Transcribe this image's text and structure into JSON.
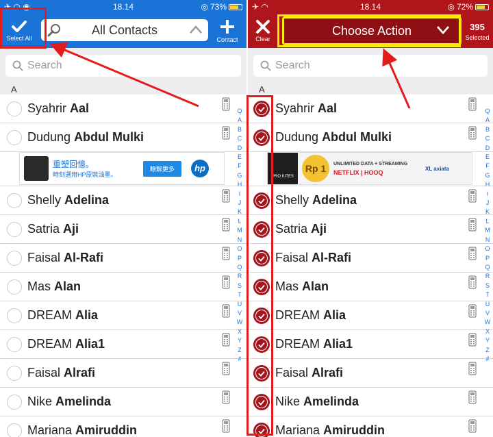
{
  "left": {
    "status": {
      "time": "18.14",
      "battery": "73%",
      "battery_level": 0.73
    },
    "select_all_label": "Select All",
    "title": "All Contacts",
    "add_label": "Contact",
    "search_placeholder": "Search",
    "section": "A",
    "contacts": [
      {
        "first": "Syahrir ",
        "last": "Aal"
      },
      {
        "first": "Dudung ",
        "last": "Abdul Mulki"
      },
      {
        "first": "Shelly ",
        "last": "Adelina"
      },
      {
        "first": "Satria ",
        "last": "Aji"
      },
      {
        "first": "Faisal ",
        "last": "Al-Rafi"
      },
      {
        "first": "Mas ",
        "last": "Alan"
      },
      {
        "first": "DREAM ",
        "last": "Alia"
      },
      {
        "first": "DREAM ",
        "last": "Alia1"
      },
      {
        "first": "Faisal ",
        "last": "Alrafi"
      },
      {
        "first": "Nike ",
        "last": "Amelinda"
      },
      {
        "first": "Mariana ",
        "last": "Amiruddin"
      }
    ],
    "ad": {
      "headline": "重塑回憶。",
      "sub": "時刻選用HP原裝油墨。",
      "cta": "瞭解更多",
      "brand": "hp"
    }
  },
  "right": {
    "status": {
      "time": "18.14",
      "battery": "72%",
      "battery_level": 0.72
    },
    "clear_label": "Clear",
    "action_label": "Choose Action",
    "selected_count": "395",
    "selected_label": "Selected",
    "search_placeholder": "Search",
    "section": "A",
    "contacts": [
      {
        "first": "Syahrir ",
        "last": "Aal"
      },
      {
        "first": "Dudung ",
        "last": "Abdul Mulki"
      },
      {
        "first": "Shelly ",
        "last": "Adelina"
      },
      {
        "first": "Satria ",
        "last": "Aji"
      },
      {
        "first": "Faisal ",
        "last": "Al-Rafi"
      },
      {
        "first": "Mas ",
        "last": "Alan"
      },
      {
        "first": "DREAM ",
        "last": "Alia"
      },
      {
        "first": "DREAM ",
        "last": "Alia1"
      },
      {
        "first": "Faisal ",
        "last": "Alrafi"
      },
      {
        "first": "Nike ",
        "last": "Amelinda"
      },
      {
        "first": "Mariana ",
        "last": "Amiruddin"
      }
    ],
    "ad": {
      "logo": "PRO KITES",
      "badge": "Rp 1",
      "headline": "UNLIMITED DATA + STREAMING",
      "partners": "NETFLIX | HOOQ",
      "brand": "XL axiata"
    }
  },
  "index_letters": [
    "Q",
    "A",
    "B",
    "C",
    "D",
    "E",
    "F",
    "G",
    "H",
    "I",
    "J",
    "K",
    "L",
    "M",
    "N",
    "O",
    "P",
    "Q",
    "R",
    "S",
    "T",
    "U",
    "V",
    "W",
    "X",
    "Y",
    "Z",
    "#"
  ],
  "colors": {
    "left_bar": "#1a73d6",
    "right_bar": "#b0151b",
    "highlight_red": "#e41b1b",
    "highlight_yellow": "#ffeb00"
  }
}
